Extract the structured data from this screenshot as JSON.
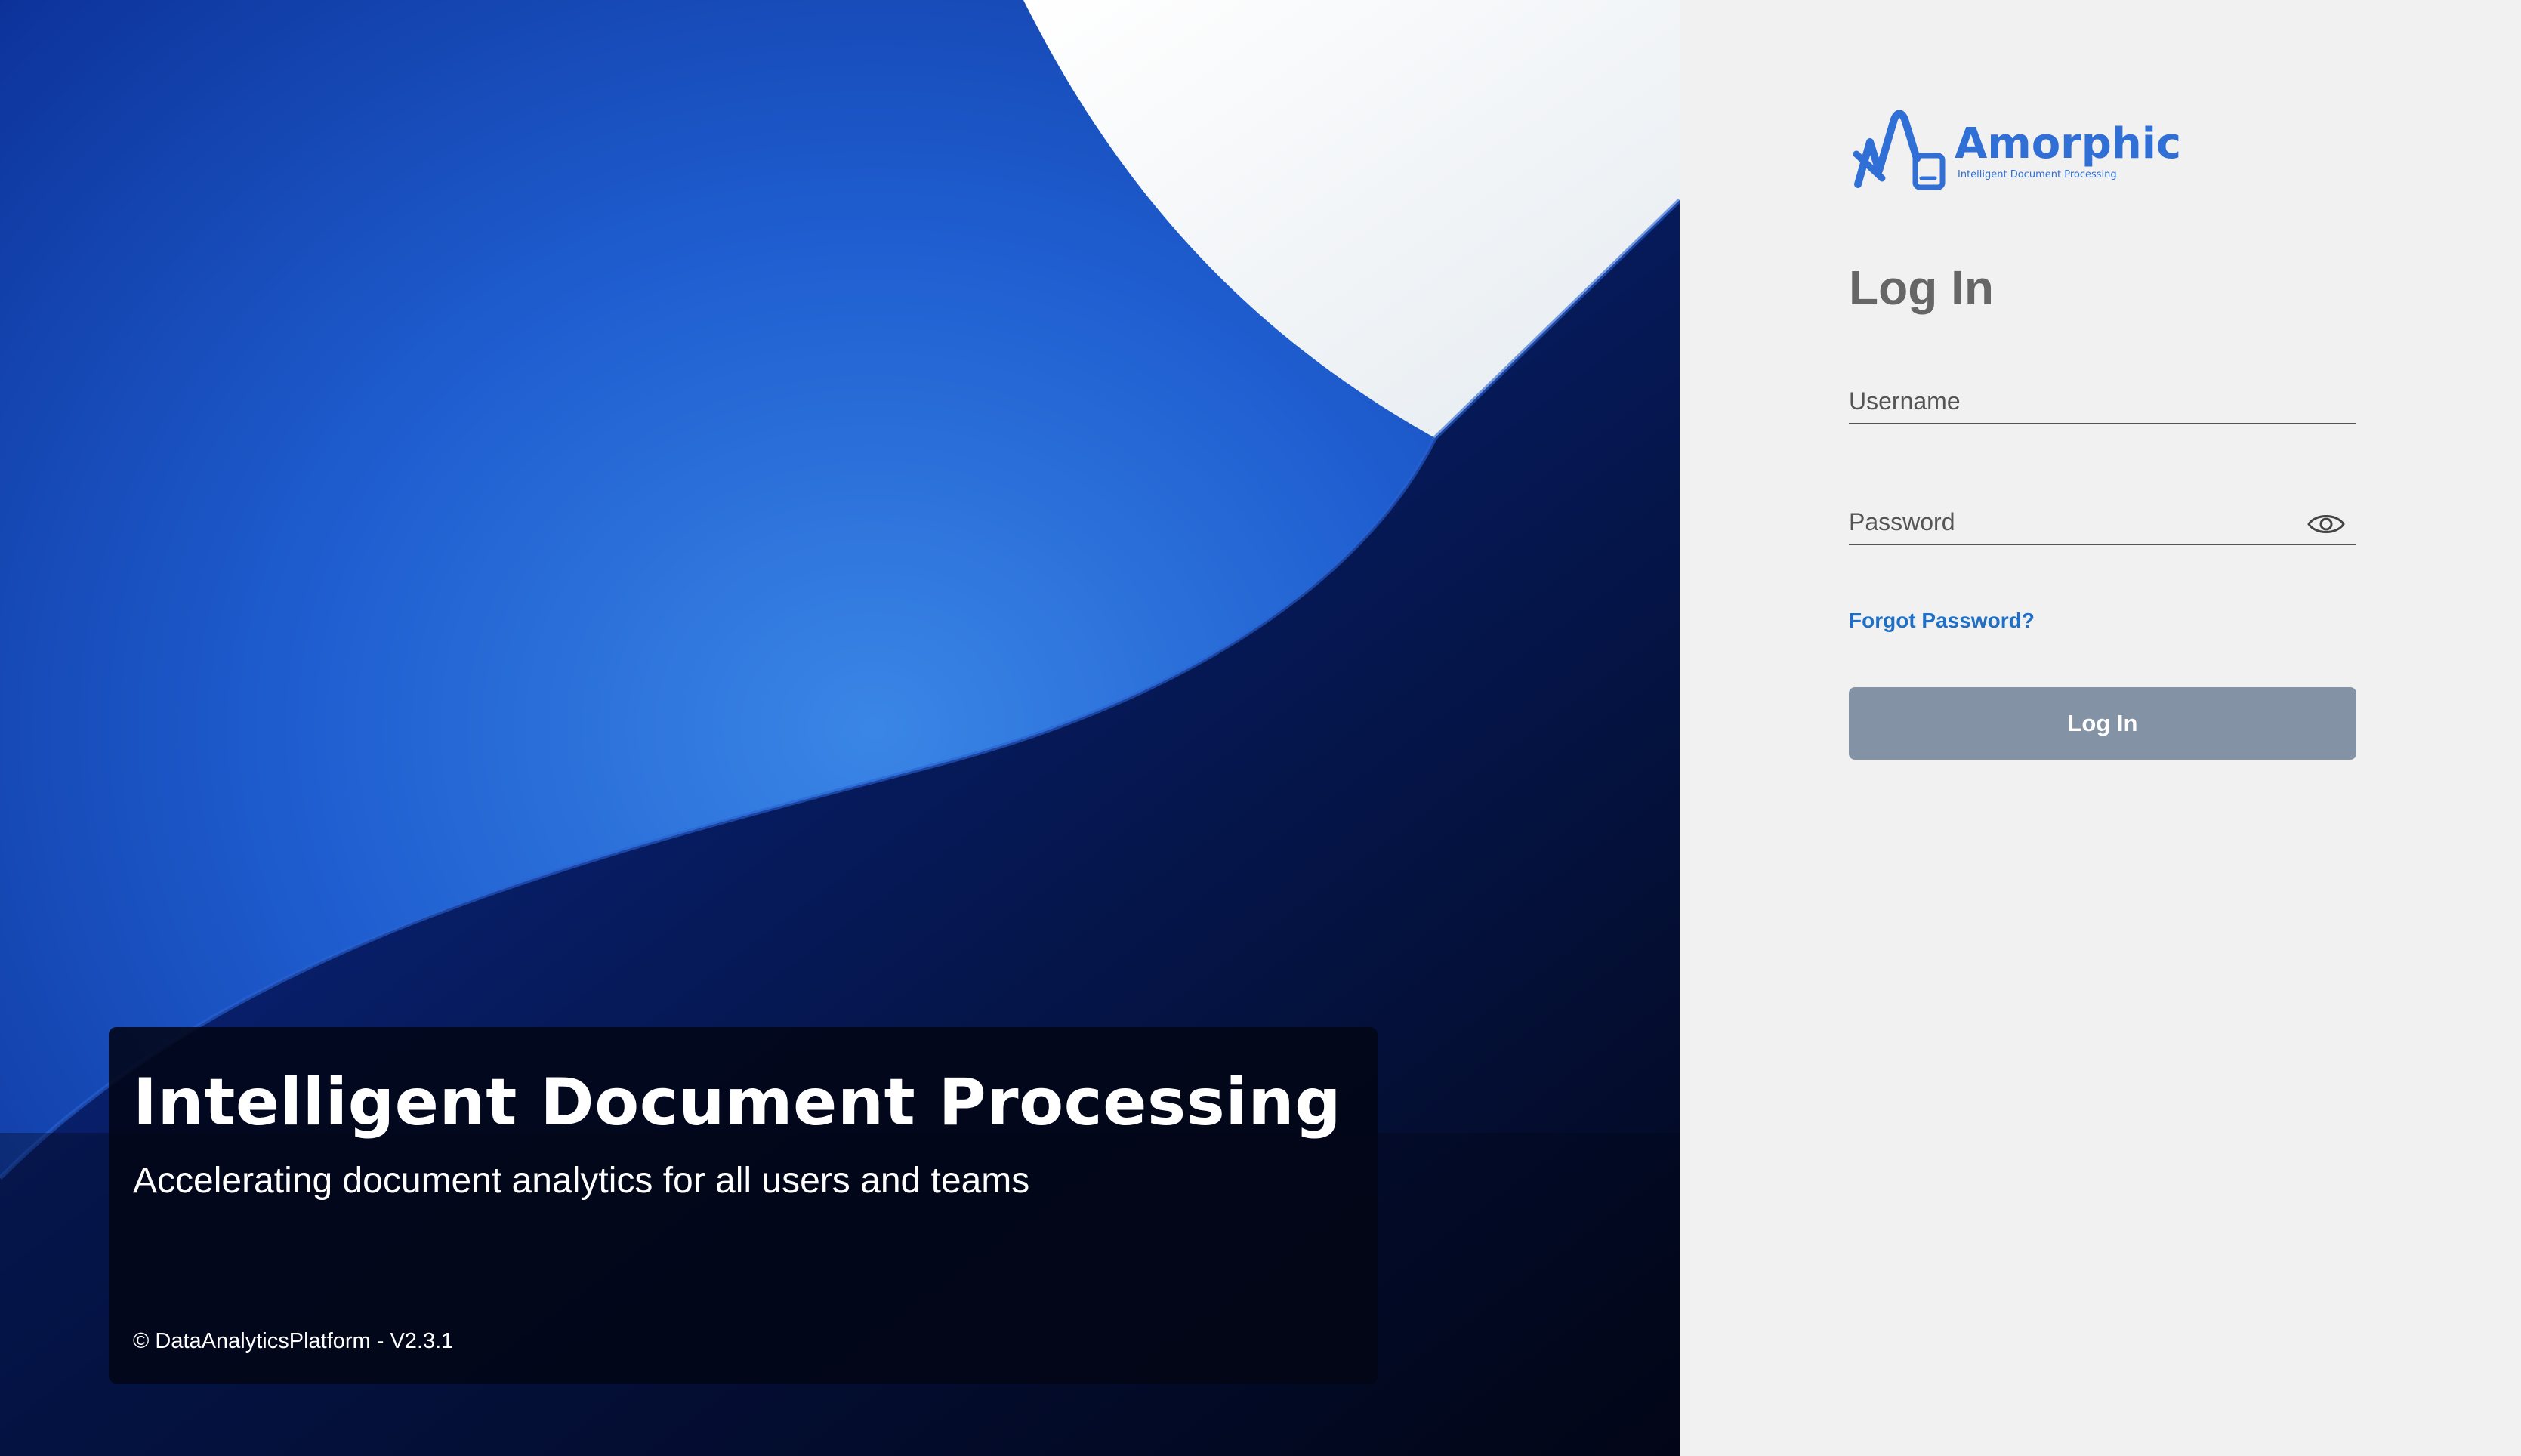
{
  "hero": {
    "title": "Intelligent Document Processing",
    "subtitle": "Accelerating document analytics for all users and teams",
    "footer": "© DataAnalyticsPlatform - V2.3.1"
  },
  "brand": {
    "name": "Amorphic",
    "tagline": "Intelligent Document Processing",
    "logo_icon": "amorphic-logo-icon",
    "color": "#2f6fd6"
  },
  "login": {
    "heading": "Log In",
    "username": {
      "placeholder": "Username",
      "value": ""
    },
    "password": {
      "placeholder": "Password",
      "value": "",
      "toggle_icon": "eye-icon"
    },
    "forgot_password": "Forgot Password?",
    "submit_label": "Log In"
  },
  "colors": {
    "hero_blue": "#1f5ed0",
    "hero_dark": "#020b2a",
    "panel_bg": "#f1f1f1",
    "link": "#1f6fc6",
    "button_disabled": "#8492a6"
  }
}
